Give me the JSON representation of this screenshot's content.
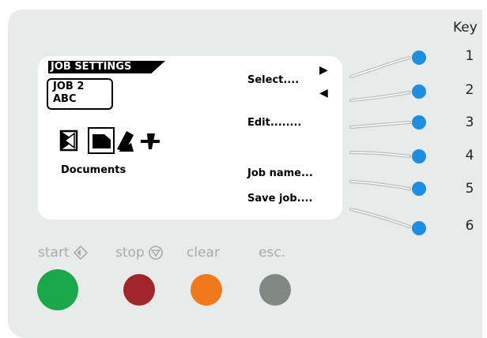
{
  "display": {
    "title": "JOB SETTINGS",
    "job_line1": "JOB  2",
    "job_line2": "ABC",
    "menu": {
      "select": "Select....",
      "edit": "Edit........",
      "job_name": "Job name...",
      "save_job": "Save job...."
    },
    "documents_label": "Documents",
    "icons": [
      "single-sheet-icon",
      "document-selected-icon",
      "folded-insert-icon",
      "envelope-fly-icon"
    ]
  },
  "key": {
    "label": "Key",
    "numbers": [
      "1",
      "2",
      "3",
      "4",
      "5",
      "6"
    ]
  },
  "controls": {
    "start": "start",
    "stop": "stop",
    "clear": "clear",
    "esc": "esc."
  },
  "colors": {
    "led": "#1e8fe0",
    "start": "#1aa84a",
    "stop": "#a1262c",
    "clear": "#f07a1b",
    "esc": "#7f8883",
    "panel": "#e9eaea"
  }
}
